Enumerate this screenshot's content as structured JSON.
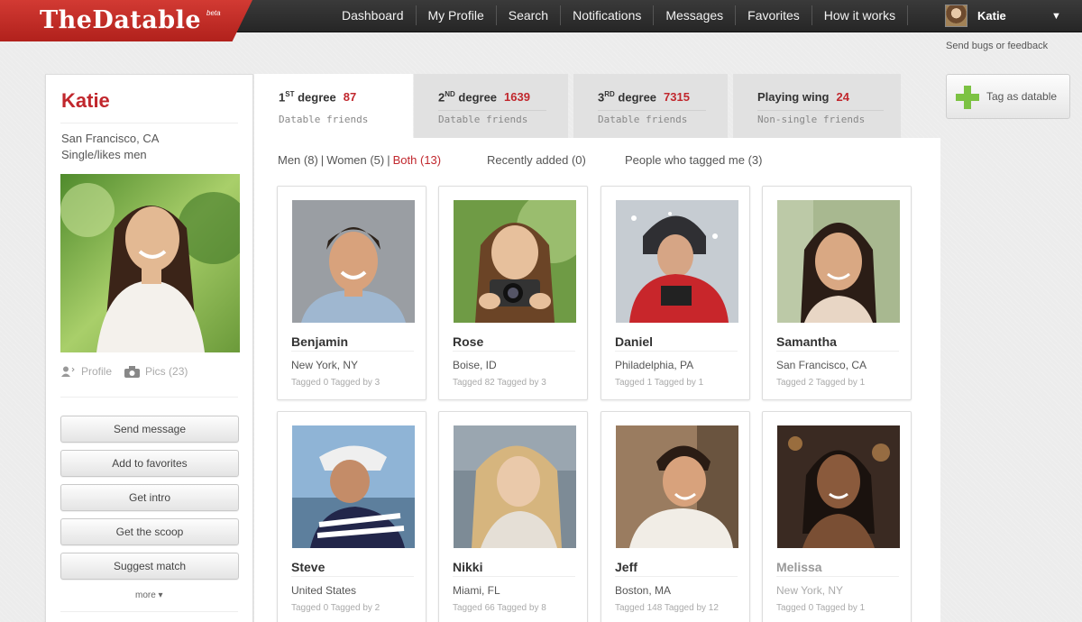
{
  "brand": {
    "name": "TheDatable",
    "beta": "beta"
  },
  "nav": {
    "items": [
      "Dashboard",
      "My Profile",
      "Search",
      "Notifications",
      "Messages",
      "Favorites",
      "How it works"
    ],
    "user": "Katie"
  },
  "feedback": "Send bugs or feedback",
  "profile": {
    "name": "Katie",
    "location": "San Francisco, CA",
    "status": "Single/likes men",
    "links": {
      "profile": "Profile",
      "pics": "Pics (23)"
    },
    "actions": [
      "Send message",
      "Add to favorites",
      "Get intro",
      "Get the scoop",
      "Suggest match"
    ],
    "more": "more ▾"
  },
  "tabs": [
    {
      "sup_base": "1",
      "sup": "ST",
      "title": " degree",
      "count": "87",
      "sub": "Datable friends",
      "active": true
    },
    {
      "sup_base": "2",
      "sup": "ND",
      "title": " degree",
      "count": "1639",
      "sub": "Datable friends",
      "active": false
    },
    {
      "sup_base": "3",
      "sup": "RD",
      "title": " degree",
      "count": "7315",
      "sub": "Datable friends",
      "active": false
    },
    {
      "sup_base": "",
      "sup": "",
      "title": "Playing wing",
      "count": "24",
      "sub": "Non-single friends",
      "active": false
    }
  ],
  "filters": {
    "men": "Men (8)",
    "sep": "|",
    "women": "Women (5)",
    "both": "Both (13)",
    "recent": "Recently added (0)",
    "tagged_me": "People who tagged me (3)"
  },
  "tag_button": "Tag as datable",
  "people": [
    {
      "name": "Benjamin",
      "location": "New York, NY",
      "tags": "Tagged 0   Tagged by 3"
    },
    {
      "name": "Rose",
      "location": "Boise, ID",
      "tags": "Tagged 82   Tagged by 3"
    },
    {
      "name": "Daniel",
      "location": "Philadelphia, PA",
      "tags": "Tagged 1   Tagged by 1"
    },
    {
      "name": "Samantha",
      "location": "San Francisco, CA",
      "tags": "Tagged 2   Tagged by 1"
    },
    {
      "name": "Steve",
      "location": "United States",
      "tags": "Tagged 0   Tagged by 2"
    },
    {
      "name": "Nikki",
      "location": "Miami, FL",
      "tags": "Tagged 66   Tagged by 8"
    },
    {
      "name": "Jeff",
      "location": "Boston, MA",
      "tags": "Tagged 148   Tagged by 12"
    },
    {
      "name": "Melissa",
      "location": "New York, NY",
      "tags": "Tagged 0   Tagged by 1"
    }
  ],
  "colors": {
    "brand_red": "#c1272d",
    "nav_dark": "#2b2b2b",
    "plus_green": "#7cc243"
  }
}
